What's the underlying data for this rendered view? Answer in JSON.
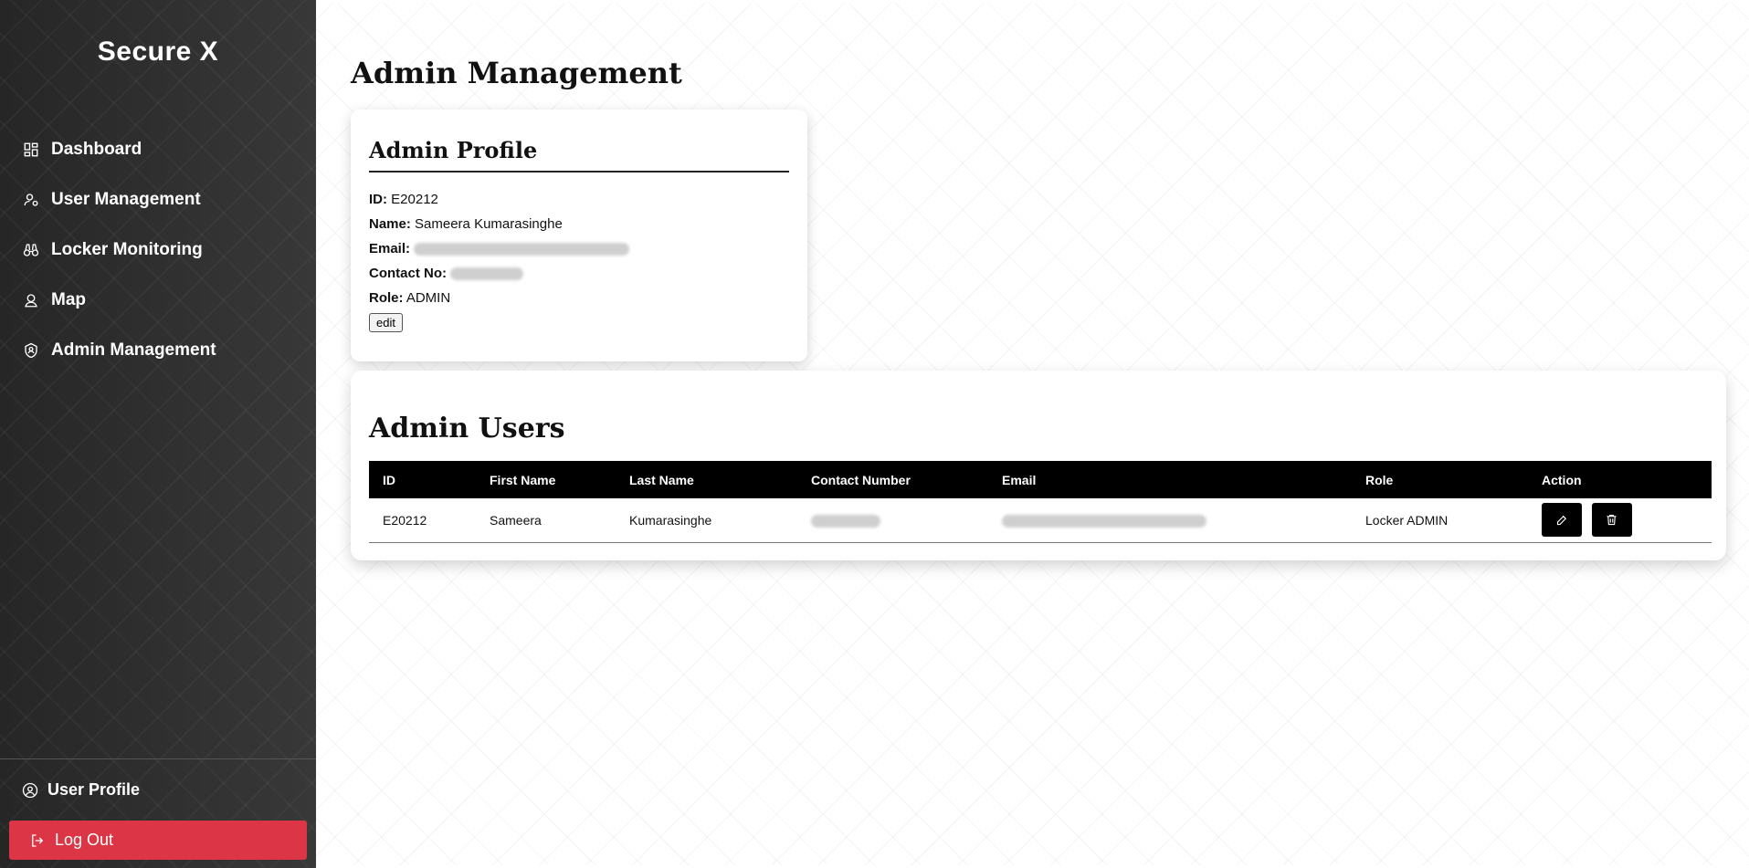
{
  "brand": "Secure X",
  "sidebar": {
    "items": [
      {
        "label": "Dashboard",
        "icon": "dashboard-icon"
      },
      {
        "label": "User Management",
        "icon": "user-icon"
      },
      {
        "label": "Locker Monitoring",
        "icon": "binoculars-icon"
      },
      {
        "label": "Map",
        "icon": "map-pin-icon"
      },
      {
        "label": "Admin Management",
        "icon": "shield-user-icon"
      }
    ],
    "user_profile": "User Profile",
    "logout": "Log Out"
  },
  "page_title": "Admin Management",
  "profile": {
    "title": "Admin Profile",
    "id_label": "ID:",
    "id_value": "E20212",
    "name_label": "Name:",
    "name_value": "Sameera Kumarasinghe",
    "email_label": "Email:",
    "contact_label": "Contact No:",
    "role_label": "Role:",
    "role_value": "ADMIN",
    "edit_label": "edit"
  },
  "admin_users": {
    "title": "Admin Users",
    "columns": [
      "ID",
      "First Name",
      "Last Name",
      "Contact Number",
      "Email",
      "Role",
      "Action"
    ],
    "rows": [
      {
        "id": "E20212",
        "first_name": "Sameera",
        "last_name": "Kumarasinghe",
        "role": "Locker ADMIN"
      }
    ]
  },
  "colors": {
    "sidebar_bg": "#2e2e2e",
    "logout_bg": "#dc3545",
    "table_header_bg": "#000000",
    "action_button_bg": "#000000"
  }
}
